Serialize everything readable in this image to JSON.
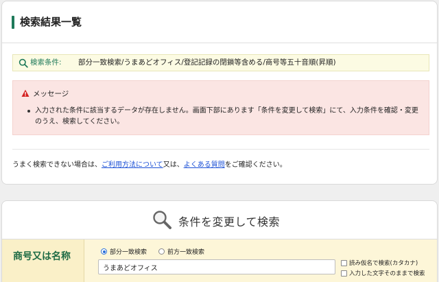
{
  "results": {
    "title": "検索結果一覧",
    "condition_label": "検索条件:",
    "condition_value": "部分一致検索/うまあどオフィス/登記記録の閉鎖等含める/商号等五十音順(昇順)",
    "message_title": "メッセージ",
    "messages": [
      "入力された条件に該当するデータが存在しません。画面下部にあります「条件を変更して検索」にて、入力条件を確認・変更のうえ、検索してください。"
    ],
    "help": {
      "prefix": "うまく検索できない場合は、",
      "link_usage": "ご利用方法について",
      "middle": "又は、",
      "link_faq": "よくある質問",
      "suffix": "をご確認ください。"
    }
  },
  "search": {
    "title": "条件を変更して検索",
    "field_label": "商号又は名称",
    "radio_partial": "部分一致検索",
    "radio_prefix": "前方一致検索",
    "name_value": "うまあどオフィス",
    "check_kana": "読み仮名で検索(カタカナ)",
    "check_exact": "入力した文字そのままで検索"
  },
  "colors": {
    "accent": "#1f7a5a",
    "link": "#1a4fd6",
    "condition_bg": "#fcfbe3",
    "message_bg": "#fbe5e3",
    "warning": "#d42020"
  }
}
